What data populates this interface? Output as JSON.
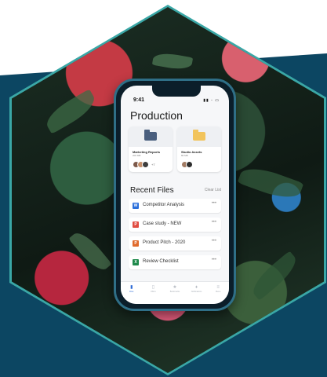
{
  "colors": {
    "background_band": "#0c4662",
    "hex_border": "#3aa7a6",
    "accent_blue": "#2f6bd6"
  },
  "phone": {
    "status_time": "9:41",
    "title": "Production",
    "cards": [
      {
        "name": "Marketing Reports",
        "sub": "200 MB",
        "folder_color": "#4a5f7e",
        "more_count": "+7"
      },
      {
        "name": "Studio Assets",
        "sub": "80 MB",
        "folder_color": "#f2c45c",
        "more_count": ""
      }
    ],
    "recent": {
      "title": "Recent Files",
      "clear": "Clear List",
      "files": [
        {
          "name": "Competitor Analysis",
          "icon": "word-doc-icon",
          "color": "#2a6fdb",
          "glyph": "W"
        },
        {
          "name": "Case study - NEW",
          "icon": "pdf-icon",
          "color": "#e14d42",
          "glyph": "P"
        },
        {
          "name": "Product Pitch - 2020",
          "icon": "powerpoint-icon",
          "color": "#e06a2c",
          "glyph": "P"
        },
        {
          "name": "Review Checklist",
          "icon": "excel-icon",
          "color": "#1f8a4c",
          "glyph": "X"
        }
      ]
    },
    "tabs": [
      {
        "label": "Files",
        "icon": "file-icon"
      },
      {
        "label": "Offers",
        "icon": "doc-icon"
      },
      {
        "label": "Bookmarks",
        "icon": "star-icon"
      },
      {
        "label": "Notifications",
        "icon": "bell-icon"
      },
      {
        "label": "Menu",
        "icon": "menu-icon"
      }
    ]
  }
}
